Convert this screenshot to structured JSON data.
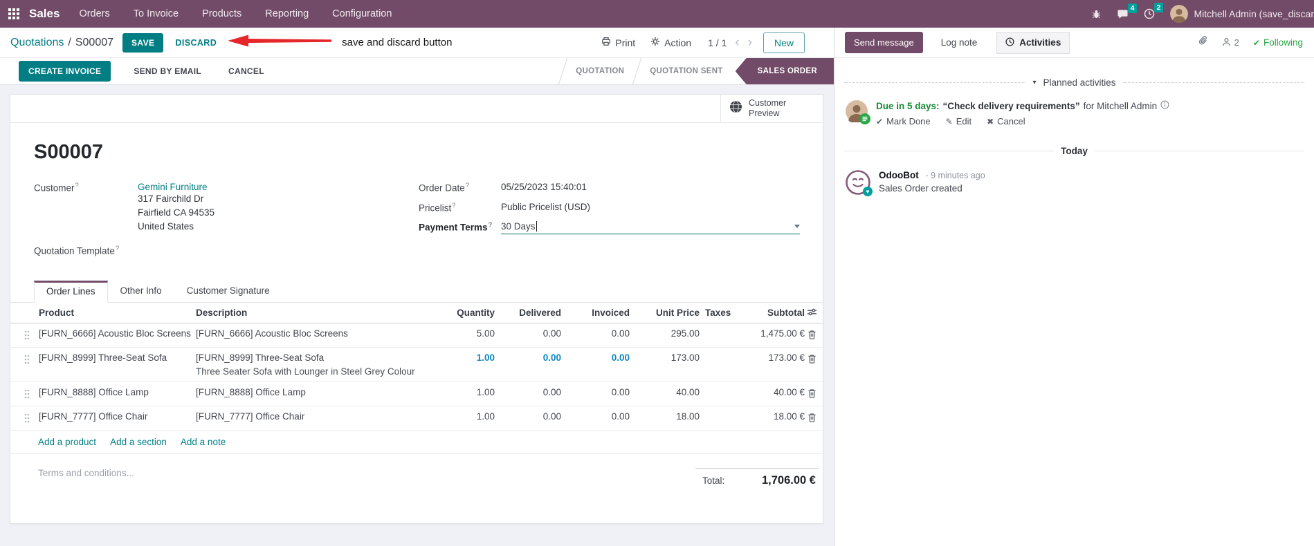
{
  "colors": {
    "brand_purple": "#714B67",
    "primary_teal": "#017E84",
    "badge_teal": "#00A09D",
    "modified_blue": "#0C86C3",
    "success_green": "#28A745",
    "activity_green": "#188A34",
    "annotation_red": "#E5262B"
  },
  "top_nav": {
    "app_name": "Sales",
    "menu_items": [
      "Orders",
      "To Invoice",
      "Products",
      "Reporting",
      "Configuration"
    ],
    "systray": {
      "messages_badge": "4",
      "activities_badge": "2",
      "user_name": "Mitchell Admin (save_discar"
    }
  },
  "control_panel": {
    "breadcrumb_parent": "Quotations",
    "breadcrumb_separator": "/",
    "breadcrumb_current": "S00007",
    "save_label": "SAVE",
    "discard_label": "DISCARD",
    "annotation_text": "save and discard button",
    "print_label": "Print",
    "action_label": "Action",
    "pager": "1 / 1",
    "new_label": "New"
  },
  "statusbar": {
    "create_invoice_label": "CREATE INVOICE",
    "send_by_email_label": "SEND BY EMAIL",
    "cancel_label": "CANCEL",
    "stages": [
      {
        "label": "QUOTATION"
      },
      {
        "label": "QUOTATION SENT"
      },
      {
        "label": "SALES ORDER"
      }
    ]
  },
  "form": {
    "customer_preview_label": "Customer Preview",
    "title": "S00007",
    "help_marker": "?",
    "customer_label": "Customer",
    "customer_value": "Gemini Furniture",
    "address_lines": [
      "317 Fairchild Dr",
      "Fairfield CA 94535",
      "United States"
    ],
    "quotation_template_label": "Quotation Template",
    "order_date_label": "Order Date",
    "order_date_value": "05/25/2023 15:40:01",
    "pricelist_label": "Pricelist",
    "pricelist_value": "Public Pricelist (USD)",
    "payment_terms_label": "Payment Terms",
    "payment_terms_value": "30 Days",
    "tabs": [
      {
        "label": "Order Lines"
      },
      {
        "label": "Other Info"
      },
      {
        "label": "Customer Signature"
      }
    ],
    "order_lines": {
      "columns": [
        "Product",
        "Description",
        "Quantity",
        "Delivered",
        "Invoiced",
        "Unit Price",
        "Taxes",
        "Subtotal"
      ],
      "rows": [
        {
          "product": "[FURN_6666] Acoustic Bloc Screens",
          "description": "[FURN_6666] Acoustic Bloc Screens",
          "quantity": "5.00",
          "delivered": "0.00",
          "invoiced": "0.00",
          "unit_price": "295.00",
          "taxes": "",
          "subtotal": "1,475.00 €"
        },
        {
          "product": "[FURN_8999] Three-Seat Sofa",
          "description": "[FURN_8999] Three-Seat Sofa",
          "description2": "Three Seater Sofa with Lounger in Steel Grey Colour",
          "quantity": "1.00",
          "delivered": "0.00",
          "invoiced": "0.00",
          "unit_price": "173.00",
          "taxes": "",
          "subtotal": "173.00 €"
        },
        {
          "product": "[FURN_8888] Office Lamp",
          "description": "[FURN_8888] Office Lamp",
          "quantity": "1.00",
          "delivered": "0.00",
          "invoiced": "0.00",
          "unit_price": "40.00",
          "taxes": "",
          "subtotal": "40.00 €"
        },
        {
          "product": "[FURN_7777] Office Chair",
          "description": "[FURN_7777] Office Chair",
          "quantity": "1.00",
          "delivered": "0.00",
          "invoiced": "0.00",
          "unit_price": "18.00",
          "taxes": "",
          "subtotal": "18.00 €"
        }
      ],
      "footer_links": [
        "Add a product",
        "Add a section",
        "Add a note"
      ],
      "terms_placeholder": "Terms and conditions...",
      "total_label": "Total:",
      "total_value": "1,706.00 €"
    }
  },
  "chatter": {
    "send_message_label": "Send message",
    "log_note_label": "Log note",
    "activities_label": "Activities",
    "followers_count": "2",
    "following_label": "Following",
    "planned_activities_label": "Planned activities",
    "activity": {
      "due_text": "Due in 5 days:",
      "summary": "“Check delivery requirements”",
      "assignee_text": "for Mitchell Admin",
      "mark_done_label": "Mark Done",
      "edit_label": "Edit",
      "cancel_label": "Cancel"
    },
    "today_label": "Today",
    "message": {
      "author": "OdooBot",
      "timestamp": "- 9 minutes ago",
      "body": "Sales Order created"
    }
  }
}
